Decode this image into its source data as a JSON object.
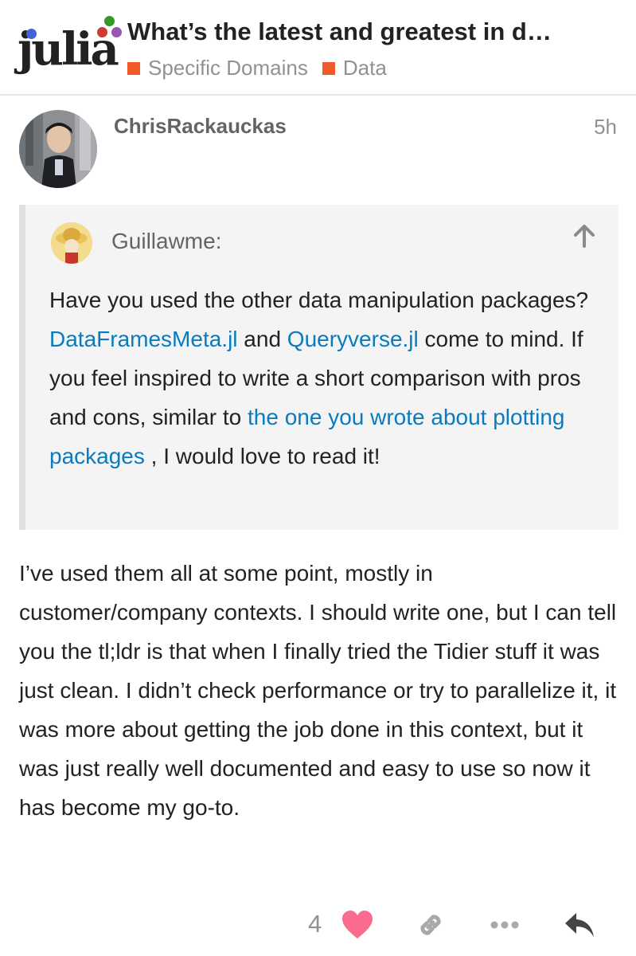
{
  "header": {
    "logo_text": "julia",
    "topic_title": "What’s the latest and greatest in d…",
    "categories": [
      {
        "label": "Specific Domains",
        "color": "#f05a28"
      },
      {
        "label": "Data",
        "color": "#f05a28"
      }
    ]
  },
  "post": {
    "username": "ChrisRackauckas",
    "time": "5h",
    "quote": {
      "user": "Guillawme:",
      "text_1": "Have you used the other data manipulation packages? ",
      "link_1": "DataFramesMeta.jl",
      "text_2": " and ",
      "link_2": "Queryverse.jl",
      "text_3": " come to mind. If you feel inspired to write a short comparison with pros and cons, similar to ",
      "link_3": "the one you wrote about plotting packages",
      "text_4": " , I would love to read it!"
    },
    "body": "I’ve used them all at some point, mostly in customer/company contexts. I should write one, but I can tell you the tl;ldr is that when I finally tried the Tidier stuff it was just clean. I didn’t check performance or try to parallelize it, it was more about getting the job done in this context, but it was just really well documented and easy to use so now it has become my go-to.",
    "actions": {
      "like_count": "4",
      "like_icon": "heart-icon",
      "share_icon": "link-icon",
      "more_icon": "ellipsis-icon",
      "reply_icon": "reply-icon"
    }
  },
  "colors": {
    "accent_link": "#0a7bbf",
    "heart": "#fa6c8d",
    "category": "#f05a28"
  }
}
